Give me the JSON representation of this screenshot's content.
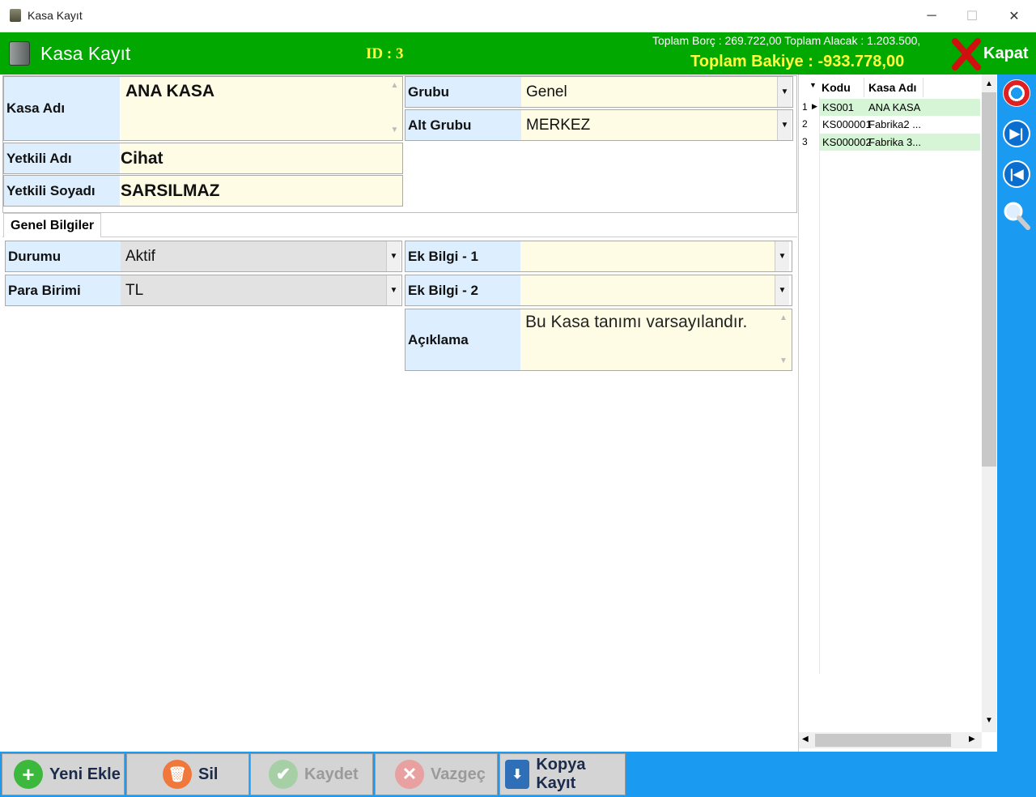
{
  "window": {
    "title": "Kasa Kayıt",
    "minimize": "─",
    "maximize": "☐",
    "close": "✕"
  },
  "header": {
    "title": "Kasa Kayıt",
    "id_text": "ID : 3",
    "totals_text": "Toplam Borç : 269.722,00   Toplam Alacak : 1.203.500,",
    "balance_text": "Toplam Bakiye : -933.778,00",
    "close_label": "Kapat"
  },
  "form": {
    "kasa_adi": {
      "label": "Kasa Adı",
      "value": "ANA KASA"
    },
    "yetkili_adi": {
      "label": "Yetkili Adı",
      "value": "Cihat"
    },
    "yetkili_soyadi": {
      "label": "Yetkili Soyadı",
      "value": "SARSILMAZ"
    },
    "grubu": {
      "label": "Grubu",
      "value": "Genel"
    },
    "alt_grubu": {
      "label": "Alt Grubu",
      "value": "MERKEZ"
    }
  },
  "tab": {
    "label": "Genel Bilgiler"
  },
  "general": {
    "durumu": {
      "label": "Durumu",
      "value": "Aktif"
    },
    "para_birimi": {
      "label": "Para Birimi",
      "value": "TL"
    },
    "ek_bilgi_1": {
      "label": "Ek Bilgi - 1",
      "value": ""
    },
    "ek_bilgi_2": {
      "label": "Ek Bilgi - 2",
      "value": ""
    },
    "aciklama": {
      "label": "Açıklama",
      "value": "Bu Kasa tanımı varsayılandır."
    }
  },
  "grid": {
    "columns": [
      "Kodu",
      "Kasa Adı"
    ],
    "rows": [
      {
        "num": "1",
        "kodu": "KS001",
        "ad": "ANA KASA"
      },
      {
        "num": "2",
        "kodu": "KS000001",
        "ad": "Fabrika2 ..."
      },
      {
        "num": "3",
        "kodu": "KS000002",
        "ad": "Fabrika 3..."
      }
    ]
  },
  "buttons": {
    "yeni_ekle": "Yeni Ekle",
    "sil": "Sil",
    "kaydet": "Kaydet",
    "vazgec": "Vazgeç",
    "kopya_kayit": "Kopya Kayıt"
  },
  "colors": {
    "header_green": "#00a800",
    "accent_blue": "#1a9af0",
    "label_bg": "#ddeeff",
    "value_bg": "#fffce6",
    "highlight_yellow": "#ffff40"
  }
}
